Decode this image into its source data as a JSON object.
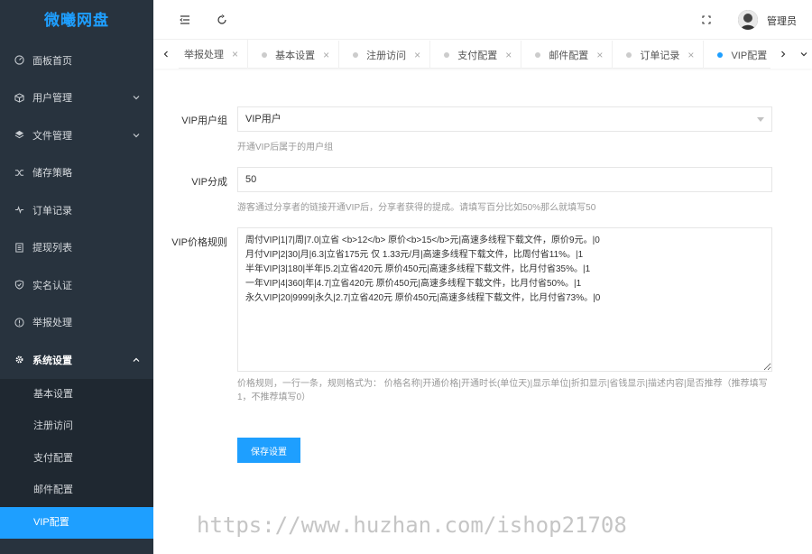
{
  "app": {
    "logo": "微曦网盘"
  },
  "sidebar": {
    "items": [
      {
        "label": "面板首页",
        "icon": "dashboard-icon"
      },
      {
        "label": "用户管理",
        "icon": "cube-icon"
      },
      {
        "label": "文件管理",
        "icon": "layers-icon"
      },
      {
        "label": "储存策略",
        "icon": "shuffle-icon"
      },
      {
        "label": "订单记录",
        "icon": "pulse-icon"
      },
      {
        "label": "提现列表",
        "icon": "list-icon"
      },
      {
        "label": "实名认证",
        "icon": "shield-check-icon"
      },
      {
        "label": "举报处理",
        "icon": "alert-icon"
      },
      {
        "label": "系统设置",
        "icon": "gear-icon"
      }
    ],
    "submenu": [
      "基本设置",
      "注册访问",
      "支付配置",
      "邮件配置",
      "VIP配置"
    ]
  },
  "header": {
    "user_name": "管理员"
  },
  "tabs": [
    {
      "label": "举报处理"
    },
    {
      "label": "基本设置"
    },
    {
      "label": "注册访问"
    },
    {
      "label": "支付配置"
    },
    {
      "label": "邮件配置"
    },
    {
      "label": "订单记录"
    },
    {
      "label": "VIP配置"
    }
  ],
  "form": {
    "vip_group_label": "VIP用户组",
    "vip_group_value": "VIP用户",
    "vip_group_hint": "开通VIP后属于的用户组",
    "vip_share_label": "VIP分成",
    "vip_share_value": "50",
    "vip_share_hint": "游客通过分享者的链接开通VIP后，分享者获得的提成。请填写百分比如50%那么就填写50",
    "vip_price_label": "VIP价格规则",
    "vip_price_value": "周付VIP|1|7|周|7.0|立省 <b>12</b> 原价<b>15</b>元|高速多线程下载文件，原价9元。|0\n月付VIP|2|30|月|6.3|立省175元 仅 1.33元/月|高速多线程下载文件，比周付省11%。|1\n半年VIP|3|180|半年|5.2|立省420元 原价450元|高速多线程下载文件，比月付省35%。|1\n一年VIP|4|360|年|4.7|立省420元 原价450元|高速多线程下载文件，比月付省50%。|1\n永久VIP|20|9999|永久|2.7|立省420元 原价450元|高速多线程下载文件，比月付省73%。|0",
    "vip_price_hint": "价格规则，一行一条，规则格式为： 价格名称|开通价格|开通时长(单位天)|显示单位|折扣显示|省钱显示|描述内容|是否推荐（推荐填写1，不推荐填写0）",
    "save_label": "保存设置"
  },
  "watermark": "https://www.huzhan.com/ishop21708",
  "colors": {
    "accent": "#1e9fff",
    "sidebar_bg": "#28333e",
    "submenu_bg": "#1f2831"
  }
}
